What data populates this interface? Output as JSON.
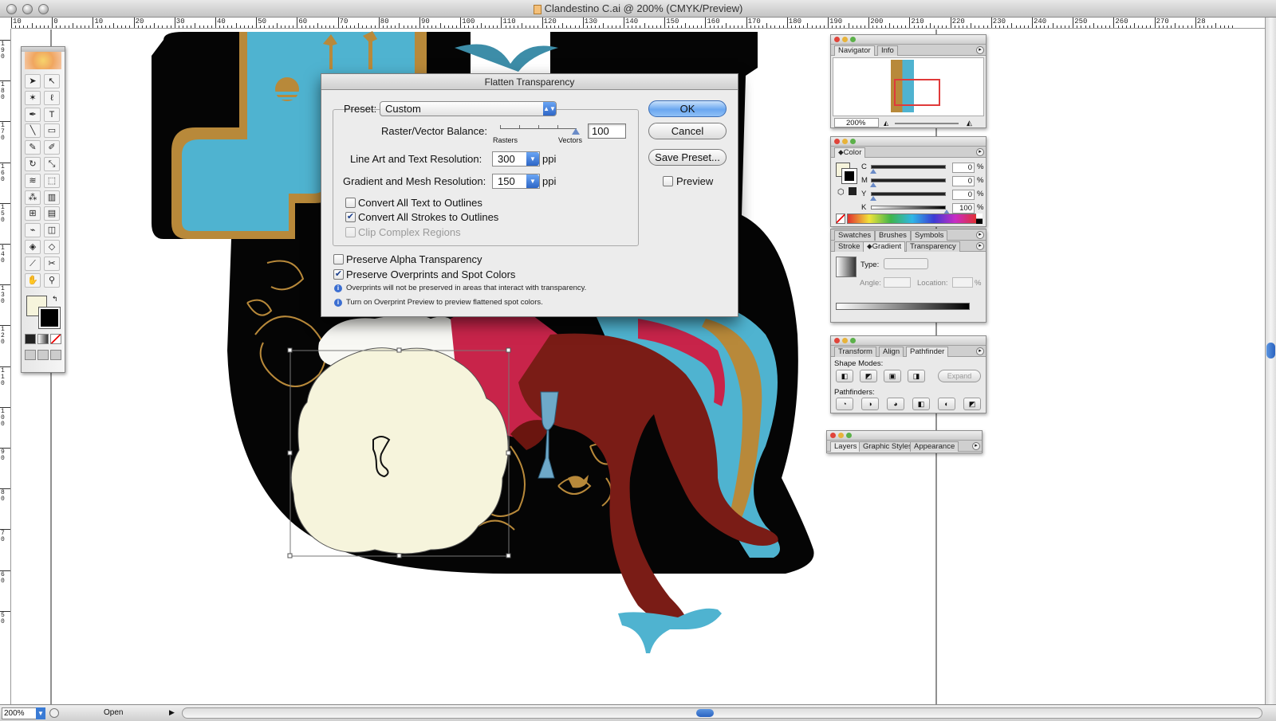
{
  "window": {
    "title": "Clandestino C.ai @ 200% (CMYK/Preview)"
  },
  "rulers": {
    "horizontal_labels": [
      "10",
      "0",
      "10",
      "20",
      "30",
      "40",
      "50",
      "60",
      "70",
      "80",
      "90",
      "100",
      "110",
      "120",
      "130",
      "140",
      "150",
      "160",
      "170",
      "180",
      "190",
      "200",
      "210",
      "220",
      "230",
      "240",
      "250",
      "260",
      "270",
      "28"
    ],
    "vertical_labels": [
      "190",
      "180",
      "170",
      "160",
      "150",
      "140",
      "130",
      "120",
      "110",
      "100",
      "90",
      "80",
      "70",
      "60",
      "50"
    ]
  },
  "status_bar": {
    "zoom": "200%",
    "status": "Open"
  },
  "dialog": {
    "title": "Flatten Transparency",
    "preset_label": "Preset:",
    "preset_value": "Custom",
    "raster_vector_label": "Raster/Vector Balance:",
    "raster_vector_value": "100",
    "slider_min_label": "Rasters",
    "slider_max_label": "Vectors",
    "line_art_label": "Line Art and Text Resolution:",
    "line_art_value": "300",
    "gradient_mesh_label": "Gradient and Mesh Resolution:",
    "gradient_mesh_value": "150",
    "ppi": "ppi",
    "convert_text": {
      "label": "Convert All Text to Outlines",
      "checked": false
    },
    "convert_strokes": {
      "label": "Convert All Strokes to Outlines",
      "checked": true
    },
    "clip_complex": {
      "label": "Clip Complex Regions",
      "checked": false,
      "enabled": false
    },
    "preserve_alpha": {
      "label": "Preserve Alpha Transparency",
      "checked": false
    },
    "preserve_overprints": {
      "label": "Preserve Overprints and Spot Colors",
      "checked": true
    },
    "note1": "Overprints will not be preserved in areas that interact with transparency.",
    "note2": "Turn on Overprint Preview to preview flattened spot colors.",
    "ok_label": "OK",
    "cancel_label": "Cancel",
    "save_preset_label": "Save Preset...",
    "preview_label": "Preview",
    "preview_checked": false
  },
  "navigator": {
    "tabs": [
      "Navigator",
      "Info"
    ],
    "zoom": "200%"
  },
  "color_panel": {
    "tab": "Color",
    "channels": [
      {
        "name": "C",
        "value": "0"
      },
      {
        "name": "M",
        "value": "0"
      },
      {
        "name": "Y",
        "value": "0"
      },
      {
        "name": "K",
        "value": "100"
      }
    ],
    "unit": "%"
  },
  "swatches_panel": {
    "tabs_top": [
      "Swatches",
      "Brushes",
      "Symbols"
    ],
    "tabs_bottom": [
      "Stroke",
      "Gradient",
      "Transparency"
    ],
    "type_label": "Type:",
    "angle_label": "Angle:",
    "location_label": "Location:",
    "unit": "%"
  },
  "pathfinder_panel": {
    "tabs": [
      "Transform",
      "Align",
      "Pathfinder"
    ],
    "shape_modes_label": "Shape Modes:",
    "pathfinders_label": "Pathfinders:",
    "expand_label": "Expand"
  },
  "layers_panel": {
    "tabs": [
      "Layers",
      "Graphic Styles",
      "Appearance"
    ]
  },
  "colors": {
    "accent": "#3a7bd5",
    "artwork_black": "#050505",
    "artwork_blue": "#4fb3d0",
    "artwork_gold": "#b8893a",
    "artwork_red": "#7a1c16",
    "artwork_pink": "#c8244a",
    "artwork_cream": "#f6f4dc"
  }
}
